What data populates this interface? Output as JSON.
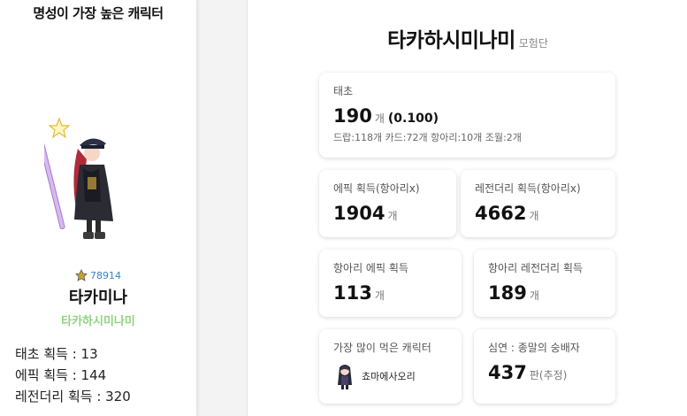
{
  "left": {
    "title": "명성이 가장 높은 캐릭터",
    "fame": "78914",
    "character_name": "타카미나",
    "adventure_name": "타카하시미나미",
    "stats": [
      "태초 획득 : 13",
      "에픽 획득 : 144",
      "레전더리 획득 : 320"
    ]
  },
  "header": {
    "title": "타카하시미나미",
    "suffix": "모험단"
  },
  "cards": {
    "taecho": {
      "label": "태초",
      "value": "190",
      "unit": "개",
      "ratio": "(0.100)",
      "breakdown": "드랍:118개 카드:72개 항아리:10개 조월:2개"
    },
    "epic": {
      "label": "에픽 획득(항아리x)",
      "value": "1904",
      "unit": "개"
    },
    "legendary": {
      "label": "레전더리 획득(항아리x)",
      "value": "4662",
      "unit": "개"
    },
    "pot_epic": {
      "label": "항아리 에픽 획득",
      "value": "113",
      "unit": "개"
    },
    "pot_legendary": {
      "label": "항아리 레전더리 획득",
      "value": "189",
      "unit": "개"
    },
    "most_eaten": {
      "label": "가장 많이 먹은 캐릭터",
      "name": "쵸마에사오리"
    },
    "abyss": {
      "label": "심연 : 종말의 숭배자",
      "value": "437",
      "unit": "판(추정)"
    }
  },
  "colors": {
    "adventure_name": "#8fd47f",
    "fame": "#3b82c4"
  }
}
